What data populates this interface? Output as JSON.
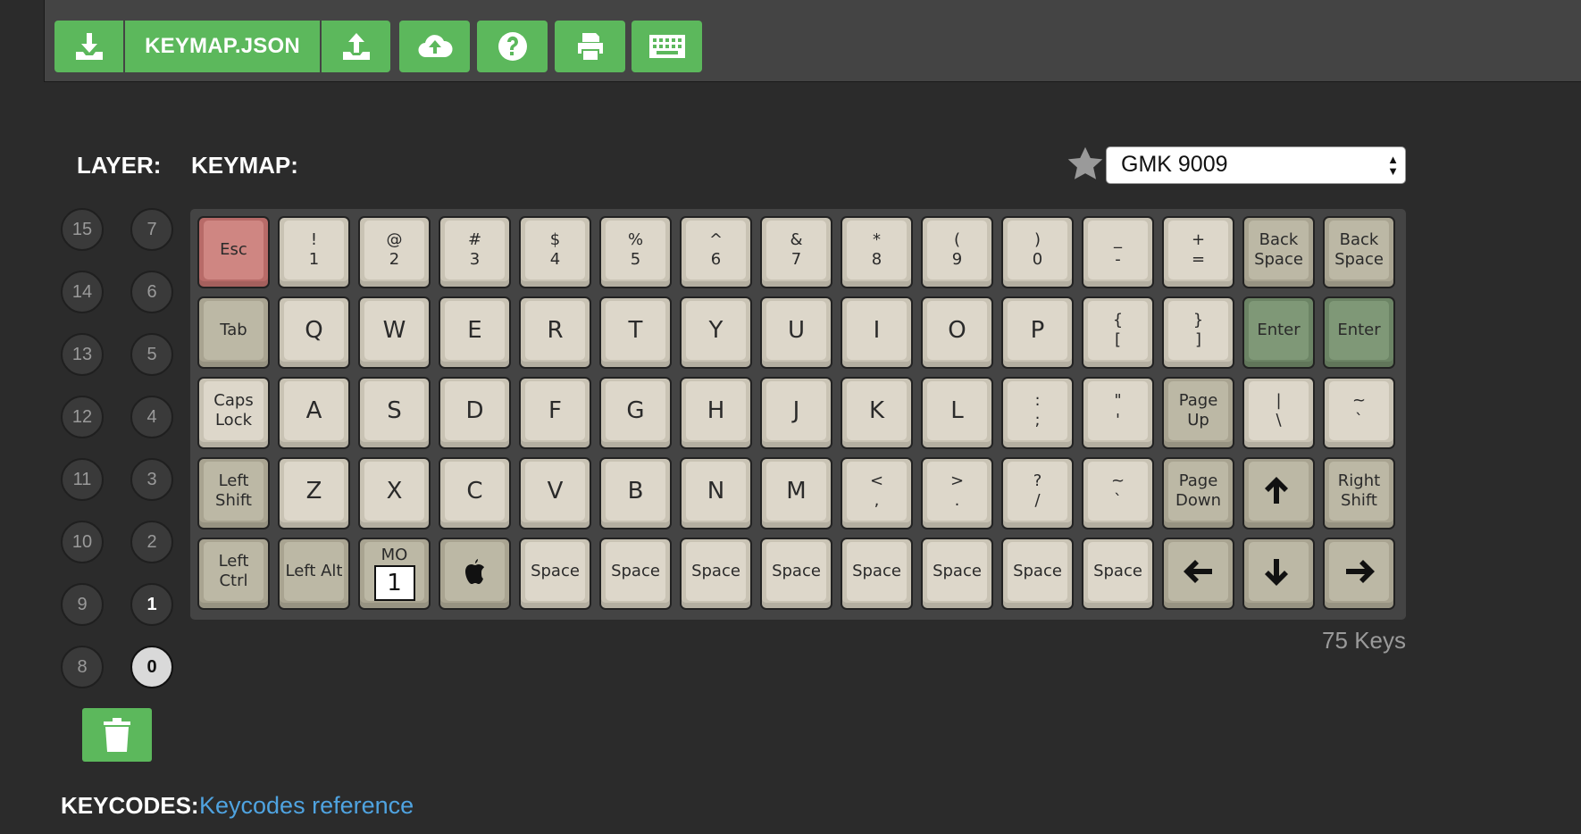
{
  "toolbar": {
    "file_label": "KEYMAP.JSON"
  },
  "labels": {
    "layer": "LAYER:",
    "keymap": "KEYMAP:",
    "keycodes": "KEYCODES:",
    "keycodes_link": "Keycodes reference"
  },
  "keymap_select": {
    "selected": "GMK 9009"
  },
  "layers": {
    "left_column": [
      "15",
      "14",
      "13",
      "12",
      "11",
      "10",
      "9",
      "8"
    ],
    "right_column": [
      "7",
      "6",
      "5",
      "4",
      "3",
      "2",
      "1",
      "0"
    ],
    "with_keys": [
      "1"
    ],
    "active": "0"
  },
  "keyboard": {
    "rows": [
      [
        {
          "top": "Esc",
          "style": "esc"
        },
        {
          "top": "!",
          "bottom": "1"
        },
        {
          "top": "@",
          "bottom": "2"
        },
        {
          "top": "#",
          "bottom": "3"
        },
        {
          "top": "$",
          "bottom": "4"
        },
        {
          "top": "%",
          "bottom": "5"
        },
        {
          "top": "^",
          "bottom": "6"
        },
        {
          "top": "&",
          "bottom": "7"
        },
        {
          "top": "*",
          "bottom": "8"
        },
        {
          "top": "(",
          "bottom": "9"
        },
        {
          "top": ")",
          "bottom": "0"
        },
        {
          "top": "_",
          "bottom": "-"
        },
        {
          "top": "+",
          "bottom": "="
        },
        {
          "top": "Back",
          "bottom": "Space",
          "style": "mod"
        },
        {
          "top": "Back",
          "bottom": "Space",
          "style": "mod"
        }
      ],
      [
        {
          "top": "Tab",
          "style": "mod"
        },
        {
          "top": "Q",
          "big": true
        },
        {
          "top": "W",
          "big": true
        },
        {
          "top": "E",
          "big": true
        },
        {
          "top": "R",
          "big": true
        },
        {
          "top": "T",
          "big": true
        },
        {
          "top": "Y",
          "big": true
        },
        {
          "top": "U",
          "big": true
        },
        {
          "top": "I",
          "big": true
        },
        {
          "top": "O",
          "big": true
        },
        {
          "top": "P",
          "big": true
        },
        {
          "top": "{",
          "bottom": "["
        },
        {
          "top": "}",
          "bottom": "]"
        },
        {
          "top": "Enter",
          "style": "enter"
        },
        {
          "top": "Enter",
          "style": "enter"
        }
      ],
      [
        {
          "top": "Caps",
          "bottom": "Lock"
        },
        {
          "top": "A",
          "big": true
        },
        {
          "top": "S",
          "big": true
        },
        {
          "top": "D",
          "big": true
        },
        {
          "top": "F",
          "big": true
        },
        {
          "top": "G",
          "big": true
        },
        {
          "top": "H",
          "big": true
        },
        {
          "top": "J",
          "big": true
        },
        {
          "top": "K",
          "big": true
        },
        {
          "top": "L",
          "big": true
        },
        {
          "top": ":",
          "bottom": ";"
        },
        {
          "top": "\"",
          "bottom": "'"
        },
        {
          "top": "Page",
          "bottom": "Up",
          "style": "mod"
        },
        {
          "top": "|",
          "bottom": "\\"
        },
        {
          "top": "~",
          "bottom": "`"
        }
      ],
      [
        {
          "top": "Left",
          "bottom": "Shift",
          "style": "mod"
        },
        {
          "top": "Z",
          "big": true
        },
        {
          "top": "X",
          "big": true
        },
        {
          "top": "C",
          "big": true
        },
        {
          "top": "V",
          "big": true
        },
        {
          "top": "B",
          "big": true
        },
        {
          "top": "N",
          "big": true
        },
        {
          "top": "M",
          "big": true
        },
        {
          "top": "<",
          "bottom": ","
        },
        {
          "top": ">",
          "bottom": "."
        },
        {
          "top": "?",
          "bottom": "/"
        },
        {
          "top": "~",
          "bottom": "`"
        },
        {
          "top": "Page",
          "bottom": "Down",
          "style": "mod"
        },
        {
          "icon": "arrow-up-icon",
          "style": "mod"
        },
        {
          "top": "Right",
          "bottom": "Shift",
          "style": "mod"
        }
      ],
      [
        {
          "top": "Left",
          "bottom": "Ctrl",
          "style": "mod"
        },
        {
          "top": "Left Alt",
          "style": "mod"
        },
        {
          "mo": "MO",
          "mo_layer": "1",
          "style": "mod"
        },
        {
          "icon": "apple-icon",
          "style": "mod"
        },
        {
          "top": "Space"
        },
        {
          "top": "Space"
        },
        {
          "top": "Space"
        },
        {
          "top": "Space"
        },
        {
          "top": "Space"
        },
        {
          "top": "Space"
        },
        {
          "top": "Space"
        },
        {
          "top": "Space"
        },
        {
          "icon": "arrow-left-icon",
          "style": "mod"
        },
        {
          "icon": "arrow-down-icon",
          "style": "mod"
        },
        {
          "icon": "arrow-right-icon",
          "style": "mod"
        }
      ]
    ],
    "key_count": "75 Keys"
  },
  "icons": {
    "toolbar": [
      "download-icon",
      "upload-icon",
      "cloud-upload-icon",
      "help-icon",
      "print-icon",
      "keyboard-icon"
    ],
    "star": "star-icon",
    "trash": "trash-icon"
  },
  "colors": {
    "accent_green": "#5cb85c",
    "link_blue": "#4fa3e0",
    "esc_red": "#cf8682",
    "enter_green": "#7f9877",
    "alpha_key": "#ddd7ca",
    "mod_key": "#bcb8a5"
  }
}
